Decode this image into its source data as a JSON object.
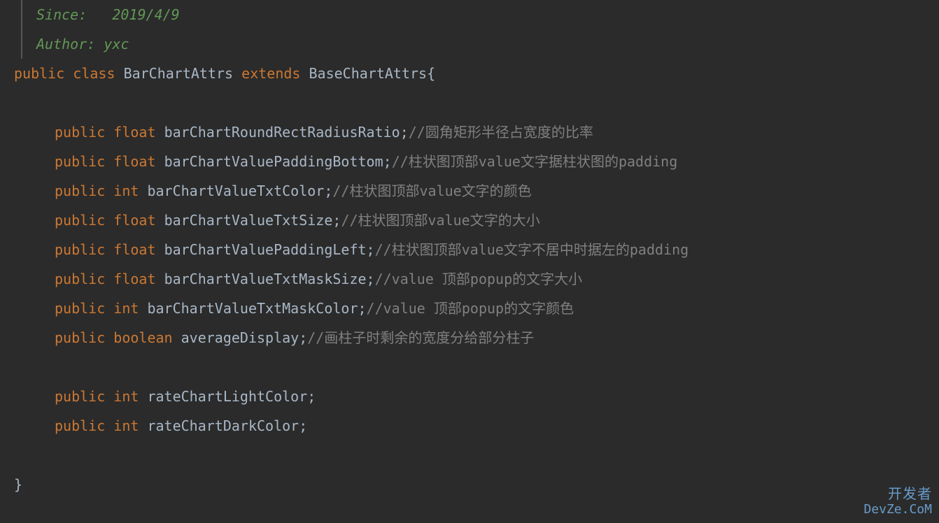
{
  "doc": {
    "since_label": "Since:",
    "since_value": "2019/4/9",
    "author_label": "Author:",
    "author_value": "yxc"
  },
  "kw": {
    "public": "public",
    "class": "class",
    "extends": "extends",
    "float": "float",
    "int": "int",
    "boolean": "boolean"
  },
  "class_name": "BarChartAttrs",
  "super_class": "BaseChartAttrs",
  "brace_open": "{",
  "brace_close": "}",
  "semi": ";",
  "fields": [
    {
      "mod": "public",
      "type": "float",
      "name": "barChartRoundRectRadiusRatio",
      "comment": "//圆角矩形半径占宽度的比率"
    },
    {
      "mod": "public",
      "type": "float",
      "name": "barChartValuePaddingBottom",
      "comment": "//柱状图顶部value文字据柱状图的padding"
    },
    {
      "mod": "public",
      "type": "int",
      "name": "barChartValueTxtColor",
      "comment": "//柱状图顶部value文字的颜色"
    },
    {
      "mod": "public",
      "type": "float",
      "name": "barChartValueTxtSize",
      "comment": "//柱状图顶部value文字的大小"
    },
    {
      "mod": "public",
      "type": "float",
      "name": "barChartValuePaddingLeft",
      "comment": "//柱状图顶部value文字不居中时据左的padding"
    },
    {
      "mod": "public",
      "type": "float",
      "name": "barChartValueTxtMaskSize",
      "comment": "//value 顶部popup的文字大小"
    },
    {
      "mod": "public",
      "type": "int",
      "name": "barChartValueTxtMaskColor",
      "comment": "//value 顶部popup的文字颜色"
    },
    {
      "mod": "public",
      "type": "boolean",
      "name": "averageDisplay",
      "comment": "//画柱子时剩余的宽度分给部分柱子"
    }
  ],
  "extra_fields": [
    {
      "mod": "public",
      "type": "int",
      "name": "rateChartLightColor"
    },
    {
      "mod": "public",
      "type": "int",
      "name": "rateChartDarkColor"
    }
  ],
  "watermark": {
    "line1": "开发者",
    "line2": "DevZe.CoM"
  }
}
